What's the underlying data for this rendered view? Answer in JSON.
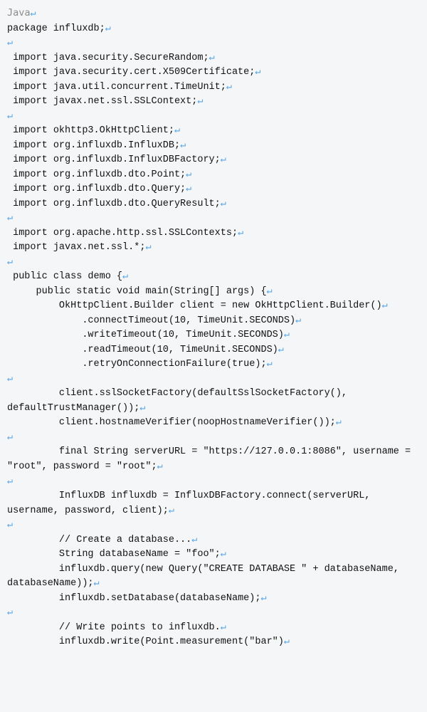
{
  "label": "Java",
  "eol_glyph": "↵",
  "lines": [
    "package influxdb;",
    "",
    " import java.security.SecureRandom;",
    " import java.security.cert.X509Certificate;",
    " import java.util.concurrent.TimeUnit;",
    " import javax.net.ssl.SSLContext;",
    "",
    " import okhttp3.OkHttpClient;",
    " import org.influxdb.InfluxDB;",
    " import org.influxdb.InfluxDBFactory;",
    " import org.influxdb.dto.Point;",
    " import org.influxdb.dto.Query;",
    " import org.influxdb.dto.QueryResult;",
    "",
    " import org.apache.http.ssl.SSLContexts;",
    " import javax.net.ssl.*;",
    "",
    " public class demo {",
    "     public static void main(String[] args) {",
    "         OkHttpClient.Builder client = new OkHttpClient.Builder()",
    "             .connectTimeout(10, TimeUnit.SECONDS)",
    "             .writeTimeout(10, TimeUnit.SECONDS)",
    "             .readTimeout(10, TimeUnit.SECONDS)",
    "             .retryOnConnectionFailure(true);",
    "",
    "         client.sslSocketFactory(defaultSslSocketFactory(), defaultTrustManager());",
    "         client.hostnameVerifier(noopHostnameVerifier());",
    "",
    "         final String serverURL = \"https://127.0.0.1:8086\", username = \"root\", password = \"root\";",
    "",
    "         InfluxDB influxdb = InfluxDBFactory.connect(serverURL, username, password, client);",
    "",
    "         // Create a database...",
    "         String databaseName = \"foo\";",
    "         influxdb.query(new Query(\"CREATE DATABASE \" + databaseName, databaseName));",
    "         influxdb.setDatabase(databaseName);",
    "",
    "         // Write points to influxdb.",
    "         influxdb.write(Point.measurement(\"bar\")"
  ]
}
